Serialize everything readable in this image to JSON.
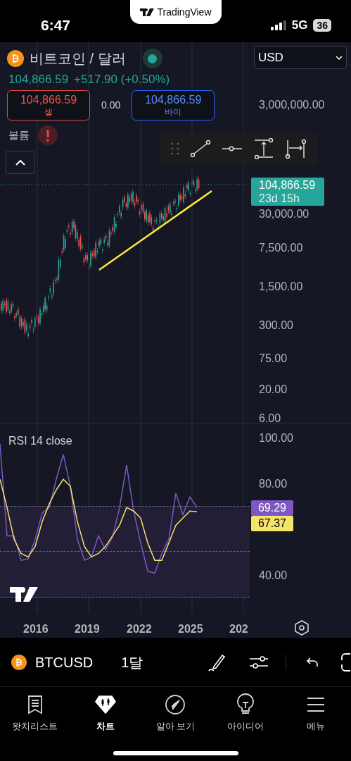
{
  "status_bar": {
    "time": "6:47",
    "app_pill": "TradingView",
    "network": "5G",
    "battery": "36"
  },
  "legend": {
    "symbol_name": "비트코인 / 달러",
    "price": "104,866.59",
    "change": "+517.90 (+0.50%)",
    "sell": {
      "price": "104,866.59",
      "label": "셀"
    },
    "spread": "0.00",
    "buy": {
      "price": "104,866.59",
      "label": "바이"
    },
    "volume_label": "볼륨"
  },
  "currency_select": {
    "value": "USD"
  },
  "price_axis": {
    "ticks": [
      "3,000,000.00",
      "30,000.00",
      "7,500.00",
      "1,500.00",
      "300.00",
      "75.00",
      "20.00",
      "6.00"
    ],
    "last_price": "104,866.59",
    "countdown": "23d 15h"
  },
  "rsi": {
    "title": "RSI 14 close",
    "rsi_value": "69.29",
    "ma_value": "67.37",
    "chart_data": {
      "type": "line",
      "ylim": [
        30,
        100
      ],
      "yticks": [
        {
          "value": 100,
          "label": "100.00"
        },
        {
          "value": 80,
          "label": "80.00"
        },
        {
          "value": 40,
          "label": "40.00"
        }
      ],
      "series": [
        {
          "color": "#7e57c2",
          "values": [
            96.9,
            56.9,
            56.9,
            46.2,
            46.8,
            55.4,
            66.8,
            69.2,
            81.5,
            92.3,
            78.5,
            55.4,
            46.2,
            47.7,
            56.9,
            50.8,
            56.3,
            69.2,
            87.7,
            67.7,
            53.8,
            41.5,
            40.6,
            49.2,
            55.4,
            75.4,
            66.2,
            73.8,
            69.3
          ]
        },
        {
          "color": "#f5e36a",
          "values": [
            81.5,
            69.2,
            55.4,
            49.2,
            47.7,
            52.3,
            63.1,
            70.8,
            76.9,
            81.5,
            78.5,
            63.1,
            52.3,
            47.7,
            49.2,
            52.3,
            56.9,
            61.5,
            69.2,
            67.7,
            64.6,
            53.8,
            46.2,
            46.2,
            53.8,
            61.5,
            64.6,
            67.7,
            67.4
          ]
        }
      ]
    }
  },
  "time_axis": [
    "2016",
    "2019",
    "2022",
    "2025",
    "202"
  ],
  "bottom_toolbar": {
    "symbol": "BTCUSD",
    "interval": "1달"
  },
  "tabs": [
    {
      "label": "왓치리스트",
      "kind": "list",
      "selected": false
    },
    {
      "label": "차트",
      "kind": "chart",
      "selected": true
    },
    {
      "label": "알아 보기",
      "kind": "compass",
      "selected": false
    },
    {
      "label": "아이디어",
      "kind": "bulb",
      "selected": false
    },
    {
      "label": "메뉴",
      "kind": "menu",
      "selected": false
    }
  ]
}
